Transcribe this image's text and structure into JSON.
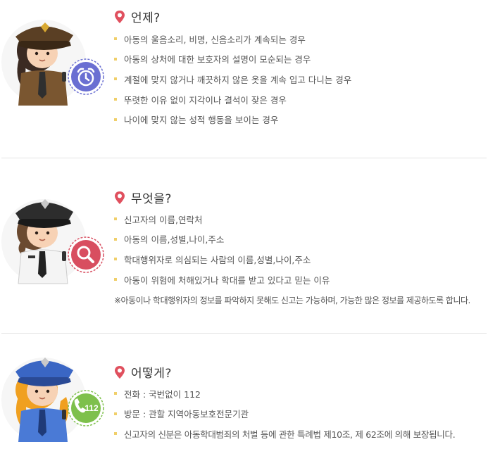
{
  "colors": {
    "pin_red": "#e0505e",
    "bullet_yellow": "#f0cf6a",
    "alarm_badge": "#6a6fd2",
    "search_badge": "#d84e60",
    "phone_badge": "#7ec04c"
  },
  "sections": [
    {
      "title": "언제?",
      "icon": "alarm-clock-icon",
      "items": [
        "아동의 울음소리, 비명, 신음소리가 계속되는 경우",
        "아동의 상처에 대한 보호자의 설명이 모순되는 경우",
        "계절에 맞지 않거나 깨끗하지 않은 옷을 계속 입고 다니는 경우",
        "뚜렷한 이유 없이 지각이나 결석이 잦은 경우",
        "나이에 맞지 않는 성적 행동을 보이는 경우"
      ]
    },
    {
      "title": "무엇을?",
      "icon": "magnifier-icon",
      "items": [
        "신고자의 이름,연락처",
        "아동의 이름,성별,나이,주소",
        "학대행위자로 의심되는 사람의 이름,성별,나이,주소",
        "아동이 위험에 처해있거나 학대를 받고 있다고 믿는 이유"
      ],
      "note": "※아동이나 학대행위자의 정보를 파악하지 못해도 신고는 가능하며, 가능한 많은 정보를 제공하도록 합니다."
    },
    {
      "title": "어떻게?",
      "icon": "phone-icon",
      "badge_text": "112",
      "items": [
        "전화 : 국번없이 112",
        "방문 : 관할 지역아동보호전문기관",
        "신고자의 신분은 아동학대범죄의 처벌 등에 관한 특례법 제10조, 제 62조에 의해 보장됩니다."
      ]
    }
  ]
}
